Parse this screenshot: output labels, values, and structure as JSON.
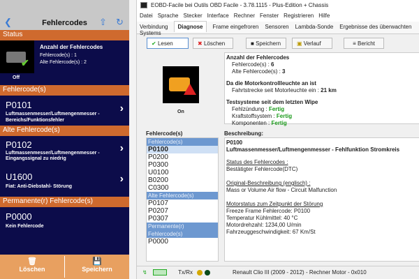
{
  "mobile": {
    "nav": {
      "title": "Fehlercodes",
      "back_icon": "chevron-left-icon",
      "share_icon": "share-icon",
      "refresh_icon": "refresh-icon"
    },
    "status": {
      "header": "Status",
      "title": "Anzahl der Fehlercodes",
      "codes": "Fehlercode(s) : 1",
      "old_codes": "Alte Fehlercode(s) : 2",
      "lamp": "Off"
    },
    "sections": [
      {
        "header": "Fehlercode(s)",
        "items": [
          {
            "code": "P0101",
            "desc1": "Luftmassenmesser/Luftmengenmesser -",
            "desc2": "Bereichs/Funktionsfehler"
          }
        ]
      },
      {
        "header": "Alte Fehlercode(s)",
        "items": [
          {
            "code": "P0102",
            "desc1": "Luftmassenmesser/Luftmengenmesser -",
            "desc2": "Eingangssignal zu niedrig"
          },
          {
            "code": "U1600",
            "desc1": "Fiat: Anti-Diebstahl- Störung",
            "desc2": ""
          }
        ]
      },
      {
        "header": "Permanente(r) Fehlercode(s)",
        "items": [
          {
            "code": "P0000",
            "desc1": "Kein Fehlercode",
            "desc2": ""
          }
        ]
      }
    ],
    "bottom": {
      "delete": "Löschen",
      "save": "Speichern"
    }
  },
  "desktop": {
    "title": "EOBD-Facile bei Outils OBD Facile - 3.78.1115 - Plus-Edition + Chassis",
    "menu": [
      "Datei",
      "Sprache",
      "Stecker",
      "Interface",
      "Rechner",
      "Fenster",
      "Registrieren",
      "Hilfe"
    ],
    "tabs": [
      "Verbindung",
      "Diagnose",
      "Frame eingefroren",
      "Sensoren",
      "Lambda-Sonde",
      "Ergebnisse des überwachten Systems"
    ],
    "active_tab": "Diagnose",
    "toolbar": {
      "read": "Lesen",
      "delete": "Löschen",
      "save": "Speichern",
      "history": "Verlauf",
      "report": "Bericht"
    },
    "lamp": "On",
    "summary": {
      "h1": "Anzahl der Fehlercodes",
      "codes_label": "Fehlercode(s) : ",
      "codes": "6",
      "old_label": "Alte Fehlercode(s) : ",
      "old": "3",
      "h2": "Da die Motorkontrollleuchte an ist",
      "dist_label": "Fahrtstrecke seit Motorleuchte ein : ",
      "dist": "21 km",
      "h3": "Testsysteme seit dem letzten Wipe",
      "tests": [
        {
          "label": "Fehlzündung : ",
          "value": "Fertig"
        },
        {
          "label": "Kraftstoffsystem : ",
          "value": "Fertig"
        },
        {
          "label": "Komponenten : ",
          "value": "Fertig"
        }
      ]
    },
    "list_label": "Fehlercode(s)",
    "list": [
      {
        "group": "Fehlercode(s)",
        "codes": [
          "P0100",
          "P0200",
          "P0300",
          "U0100",
          "B0200",
          "C0300"
        ]
      },
      {
        "group": "Alte Fehlercode(s)",
        "codes": [
          "P0107",
          "P0207",
          "P0307"
        ]
      },
      {
        "group": "Permanente(r) Fehlercode(s)",
        "codes": [
          "P0000"
        ]
      }
    ],
    "selected": "P0100",
    "desc": {
      "label": "Beschreibung:",
      "code": "P0100",
      "title": "Luftmassenmesser/Luftmengenmesser - Fehlfunktion Stromkreis",
      "status_h": "Status des Fehlercodes :",
      "status": "Bestätigter Fehlercode(DTC)",
      "orig_h": "Original-Beschreibung (englisch) :",
      "orig": "Mass or Volume Air flow - Circuit Malfunction",
      "motor_h": "Motorstatus zum Zeitpunkt der Störung",
      "motor": [
        "Freeze Frame Fehlercode: P0100",
        "Temperatur Kühlmittel: 40 °C",
        "Motordrehzahl: 1234,00 U/min",
        "Fahrzeuggeschwindigkeit: 67 Km/St"
      ]
    },
    "statusbar": {
      "txrx": "Tx/Rx",
      "vehicle": "Renault Clio III (2009 - 2012) - Rechner Motor - 0x010"
    },
    "colors": {
      "accent_orange": "#cf6a2e",
      "navy": "#0c0c4a",
      "fertig": "#1a9a1a",
      "list_group": "#6d98d0"
    }
  }
}
